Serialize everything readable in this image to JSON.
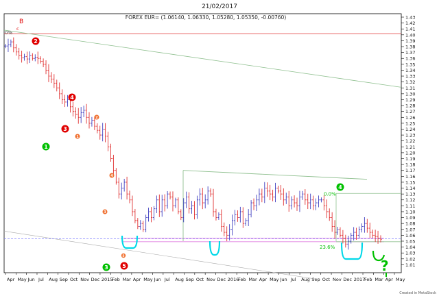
{
  "header": {
    "date": "21/02/2017",
    "instrument": "FOREX EUR= (1.06140, 1.06330, 1.05280, 1.05350, -0.00760)"
  },
  "footer": {
    "credit": "Created in MetaStock"
  },
  "chart_data": {
    "type": "ohlc-bar",
    "ylim": [
      1.0,
      1.43
    ],
    "yticks": [
      "1.43",
      "1.42",
      "1.41",
      "1.40",
      "1.39",
      "1.38",
      "1.37",
      "1.36",
      "1.35",
      "1.34",
      "1.33",
      "1.32",
      "1.31",
      "1.30",
      "1.29",
      "1.28",
      "1.27",
      "1.26",
      "1.25",
      "1.24",
      "1.23",
      "1.22",
      "1.21",
      "1.20",
      "1.19",
      "1.18",
      "1.17",
      "1.16",
      "1.15",
      "1.14",
      "1.13",
      "1.12",
      "1.11",
      "1.10",
      "1.09",
      "1.08",
      "1.07",
      "1.06",
      "1.05",
      "1.04",
      "1.03",
      "1.02",
      "1.01"
    ],
    "xticks": [
      "Apr",
      "May",
      "Jun",
      "Jul",
      "Aug",
      "Sep",
      "Oct",
      "Nov",
      "Dec",
      "2015",
      "Feb",
      "Mar",
      "Apr",
      "May",
      "Jun",
      "Jul",
      "Aug",
      "Sep",
      "Oct",
      "Nov",
      "Dec",
      "2016",
      "Feb",
      "Mar",
      "Apr",
      "May",
      "Jun",
      "Jul",
      "Aug",
      "Sep",
      "Oct",
      "Nov",
      "Dec",
      "2017",
      "Feb",
      "Mar",
      "Apr",
      "May"
    ],
    "closes": [
      1.381,
      1.383,
      1.388,
      1.378,
      1.371,
      1.365,
      1.361,
      1.363,
      1.359,
      1.365,
      1.36,
      1.362,
      1.36,
      1.355,
      1.35,
      1.34,
      1.33,
      1.325,
      1.318,
      1.31,
      1.3,
      1.29,
      1.286,
      1.29,
      1.278,
      1.27,
      1.265,
      1.26,
      1.268,
      1.272,
      1.26,
      1.25,
      1.255,
      1.245,
      1.238,
      1.23,
      1.24,
      1.228,
      1.21,
      1.19,
      1.17,
      1.15,
      1.13,
      1.14,
      1.15,
      1.13,
      1.12,
      1.1,
      1.085,
      1.075,
      1.08,
      1.07,
      1.09,
      1.1,
      1.09,
      1.105,
      1.12,
      1.1,
      1.12,
      1.11,
      1.13,
      1.125,
      1.11,
      1.12,
      1.1,
      1.09,
      1.115,
      1.125,
      1.105,
      1.11,
      1.095,
      1.12,
      1.13,
      1.115,
      1.12,
      1.135,
      1.13,
      1.1,
      1.09,
      1.095,
      1.075,
      1.065,
      1.06,
      1.07,
      1.085,
      1.095,
      1.09,
      1.1,
      1.08,
      1.085,
      1.095,
      1.115,
      1.11,
      1.12,
      1.13,
      1.125,
      1.14,
      1.135,
      1.13,
      1.125,
      1.14,
      1.135,
      1.13,
      1.12,
      1.125,
      1.11,
      1.12,
      1.115,
      1.11,
      1.125,
      1.13,
      1.12,
      1.115,
      1.12,
      1.11,
      1.115,
      1.12,
      1.12,
      1.11,
      1.1,
      1.09,
      1.075,
      1.065,
      1.07,
      1.06,
      1.055,
      1.045,
      1.05,
      1.06,
      1.065,
      1.06,
      1.07,
      1.075,
      1.08,
      1.072,
      1.065,
      1.06,
      1.058,
      1.055,
      1.053
    ],
    "annotations": {
      "top_zero_label": "0%",
      "fib_0_label": "0.0%",
      "fib_236_label": "23.6%",
      "wave_B": "B",
      "wave_c": "c",
      "question_mark": "?",
      "circled": [
        {
          "label": "2",
          "color": "#e00000"
        },
        {
          "label": "4",
          "color": "#e00000"
        },
        {
          "label": "3",
          "color": "#e00000"
        },
        {
          "label": "1",
          "color": "#f07030"
        },
        {
          "label": "2",
          "color": "#f07030"
        },
        {
          "label": "1",
          "color": "#00c000"
        },
        {
          "label": "4",
          "color": "#f07030"
        },
        {
          "label": "3",
          "color": "#f07030"
        },
        {
          "label": "5",
          "color": "#f07030"
        },
        {
          "label": "5",
          "color": "#e00000"
        },
        {
          "label": "3",
          "color": "#00c000"
        },
        {
          "label": "4",
          "color": "#00c000"
        }
      ]
    },
    "colors": {
      "up": "#4040c0",
      "down": "#e03030",
      "resistance": "#e03030",
      "channel": "#90c090",
      "support": "#e080e0",
      "support_dash": "#8080ff",
      "cyan": "#00d8e8",
      "green": "#00c000"
    }
  }
}
